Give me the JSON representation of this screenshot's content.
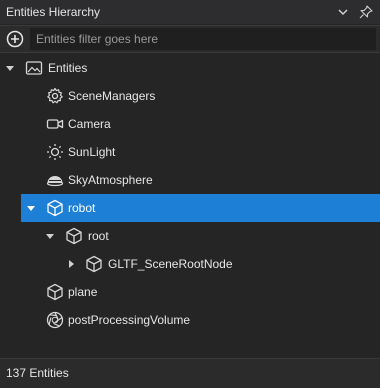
{
  "panel": {
    "title": "Entities Hierarchy"
  },
  "filter": {
    "placeholder": "Entities filter goes here"
  },
  "tree": {
    "root_label": "Entities",
    "items": [
      {
        "label": "SceneManagers"
      },
      {
        "label": "Camera"
      },
      {
        "label": "SunLight"
      },
      {
        "label": "SkyAtmosphere"
      },
      {
        "label": "robot"
      },
      {
        "label": "root"
      },
      {
        "label": "GLTF_SceneRootNode"
      },
      {
        "label": "plane"
      },
      {
        "label": "postProcessingVolume"
      }
    ]
  },
  "status": {
    "count_text": "137 Entities"
  },
  "colors": {
    "background": "#252526",
    "selection": "#1e7fd6",
    "text": "#e6e6e6"
  }
}
